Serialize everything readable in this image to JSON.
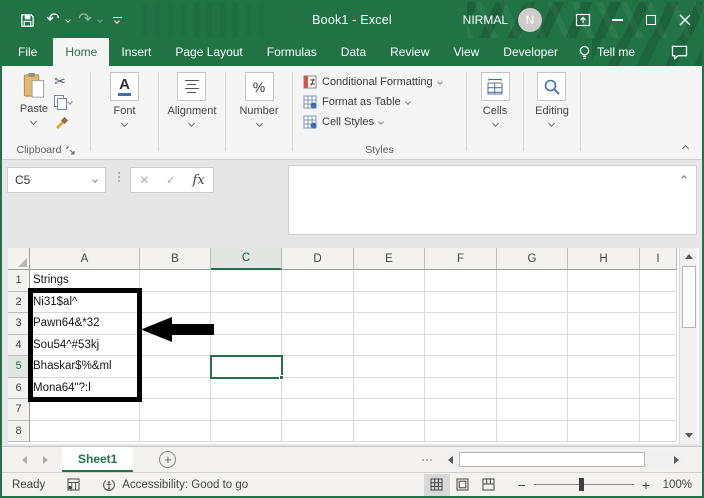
{
  "window": {
    "title": "Book1 - Excel",
    "user_name": "NIRMAL",
    "avatar_initial": "N"
  },
  "ribbon": {
    "tabs": [
      {
        "label": "File",
        "active": false
      },
      {
        "label": "Home",
        "active": true
      },
      {
        "label": "Insert",
        "active": false
      },
      {
        "label": "Page Layout",
        "active": false
      },
      {
        "label": "Formulas",
        "active": false
      },
      {
        "label": "Data",
        "active": false
      },
      {
        "label": "Review",
        "active": false
      },
      {
        "label": "View",
        "active": false
      },
      {
        "label": "Developer",
        "active": false
      }
    ],
    "tell_me_label": "Tell me",
    "clipboard": {
      "paste_label": "Paste",
      "group_label": "Clipboard"
    },
    "font_label": "Font",
    "alignment_label": "Alignment",
    "number_label": "Number",
    "styles": {
      "items": [
        "Conditional Formatting",
        "Format as Table",
        "Cell Styles"
      ],
      "group_label": "Styles"
    },
    "cells_label": "Cells",
    "editing_label": "Editing"
  },
  "formula_bar": {
    "name_box_value": "C5",
    "fx_label": "fx"
  },
  "grid": {
    "column_headers": [
      "A",
      "B",
      "C",
      "D",
      "E",
      "F",
      "G",
      "H",
      "I"
    ],
    "row_headers": [
      "1",
      "2",
      "3",
      "4",
      "5",
      "6",
      "7",
      "8"
    ],
    "selected_cell": "C5",
    "selected_column": "C",
    "selected_row": "5",
    "cells": {
      "A1": "Strings",
      "A2": "Ni31$al^",
      "A3": "Pawn64&*32",
      "A4": "Sou54^#53kj",
      "A5": "Bhaskar$%&ml",
      "A6": "Mona64\"?:l"
    }
  },
  "sheet_bar": {
    "active_sheet": "Sheet1",
    "add_sheet_label": "+"
  },
  "status_bar": {
    "mode": "Ready",
    "accessibility": "Accessibility: Good to go",
    "zoom_out_label": "−",
    "zoom_in_label": "+",
    "zoom_level": "100%"
  },
  "colors": {
    "excel_green": "#217346",
    "selection_border": "#217346"
  },
  "icons": {
    "undo": "↶",
    "redo": "↷",
    "cut": "✂"
  }
}
